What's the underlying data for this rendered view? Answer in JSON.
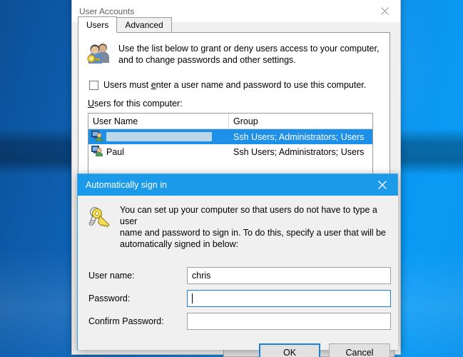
{
  "desktop": {
    "name": "windows-desktop-wallpaper"
  },
  "user_accounts_window": {
    "title": "User Accounts",
    "close_icon": "close-icon",
    "tabs": [
      {
        "label": "Users",
        "selected": true
      },
      {
        "label": "Advanced",
        "selected": false
      }
    ],
    "intro": {
      "icon": "users-group-icon",
      "line1": "Use the list below to grant or deny users access to your computer,",
      "line2": "and to change passwords and other settings."
    },
    "checkbox": {
      "checked": false,
      "label_before": "Users must ",
      "label_accel": "e",
      "label_after": "nter a user name and password to use this computer."
    },
    "list_label_accel": "U",
    "list_label_rest": "sers for this computer:",
    "list": {
      "columns": [
        "User Name",
        "Group"
      ],
      "rows": [
        {
          "icon": "user-account-icon",
          "name": "",
          "name_redacted": true,
          "group": "Ssh Users; Administrators; Users",
          "selected": true
        },
        {
          "icon": "user-account-icon",
          "name": "Paul",
          "name_redacted": false,
          "group": "Ssh Users; Administrators; Users",
          "selected": false
        }
      ]
    },
    "bottom_buttons": [
      {
        "label": ""
      },
      {
        "label": ""
      },
      {
        "label": ""
      }
    ]
  },
  "autologon_dialog": {
    "title": "Automatically sign in",
    "close_icon": "close-icon",
    "accent_color": "#1a9ae8",
    "intro": {
      "icon": "keys-icon",
      "line1": "You can set up your computer so that users do not have to type a user",
      "line2": "name and password to sign in. To do this, specify a user that will be",
      "line3": "automatically signed in below:"
    },
    "fields": [
      {
        "label": "User name:",
        "value": "chris",
        "focused": false,
        "masked": false
      },
      {
        "label": "Password:",
        "value": "",
        "focused": true,
        "masked": true
      },
      {
        "label": "Confirm Password:",
        "value": "",
        "focused": false,
        "masked": true
      }
    ],
    "buttons": [
      {
        "label": "OK",
        "default": true
      },
      {
        "label": "Cancel",
        "default": false
      }
    ]
  }
}
